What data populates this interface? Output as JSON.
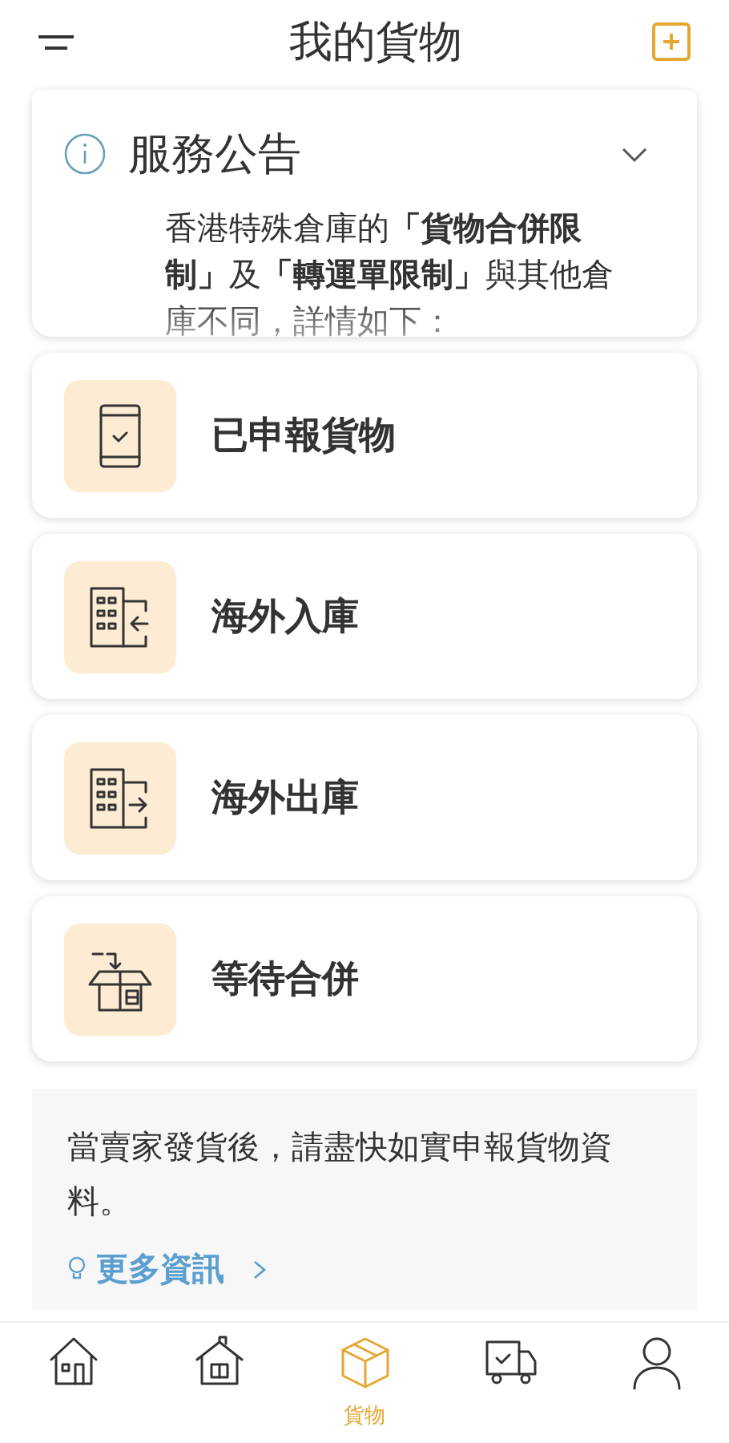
{
  "header": {
    "title": "我的貨物"
  },
  "announcement": {
    "title": "服務公告",
    "expanded": false,
    "body": "香港特殊倉庫的**「貨物合併限制」**及**「轉運單限制」**與其他倉庫不同，詳情如下："
  },
  "menu": [
    {
      "label": "已申報貨物"
    },
    {
      "label": "海外入庫"
    },
    {
      "label": "海外出庫"
    },
    {
      "label": "等待合併"
    }
  ],
  "info": {
    "text": "當賣家發貨後，請盡快如實申報貨物資料。",
    "link": "更多資訊"
  },
  "bottom_nav": [
    {
      "selected": false
    },
    {
      "selected": false
    },
    {
      "label": "貨物",
      "selected": true
    },
    {
      "selected": false
    },
    {
      "selected": false
    }
  ]
}
